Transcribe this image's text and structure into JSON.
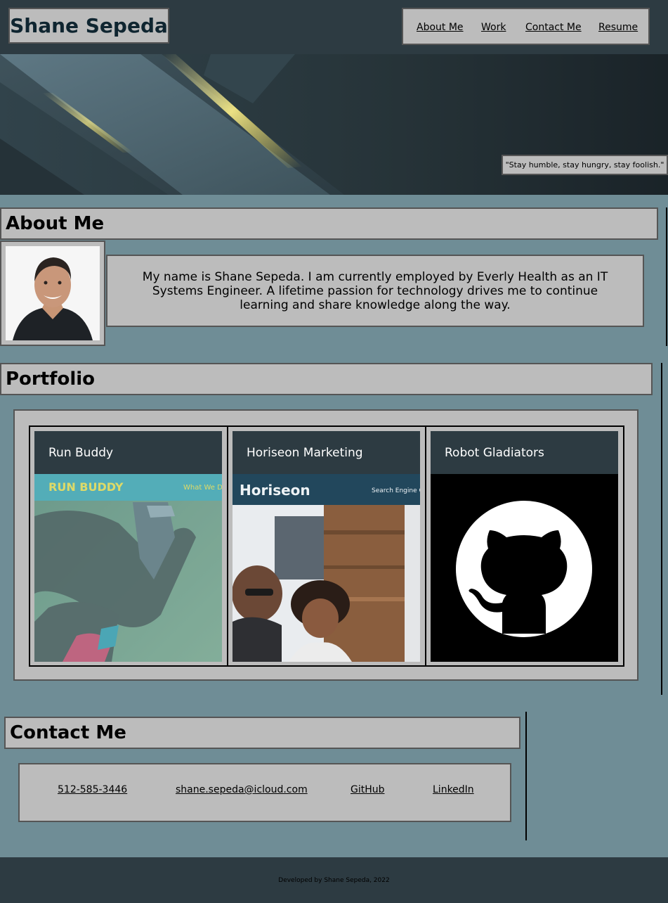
{
  "header": {
    "brand": "Shane Sepeda",
    "nav": [
      "About Me",
      "Work",
      "Contact Me",
      "Resume"
    ]
  },
  "hero": {
    "quote": "\"Stay humble, stay hungry, stay foolish.\""
  },
  "about": {
    "title": "About Me",
    "bio": "My name is Shane Sepeda. I am currently employed by Everly Health as an IT Systems Engineer. A lifetime passion for technology drives me to continue learning and share knowledge along the way."
  },
  "portfolio": {
    "title": "Portfolio",
    "cards": [
      {
        "title": "Run Buddy",
        "image_brand": "RUN BUDDY",
        "image_nav": "What We Do"
      },
      {
        "title": "Horiseon Marketing",
        "image_brand": "Horiseon",
        "image_nav": "Search Engine Optimization"
      },
      {
        "title": "Robot Gladiators",
        "image_icon": "github-octocat-icon"
      }
    ]
  },
  "contact": {
    "title": "Contact Me",
    "links": [
      "512-585-3446",
      "shane.sepeda@icloud.com",
      "GitHub",
      "LinkedIn"
    ]
  },
  "footer": {
    "text": "Developed by Shane Sepeda, 2022"
  },
  "colors": {
    "background": "#6f8d96",
    "header": "#2d3b42",
    "panel": "#bcbcbc",
    "panel_border": "#555555",
    "brand_text": "#0f2530"
  }
}
